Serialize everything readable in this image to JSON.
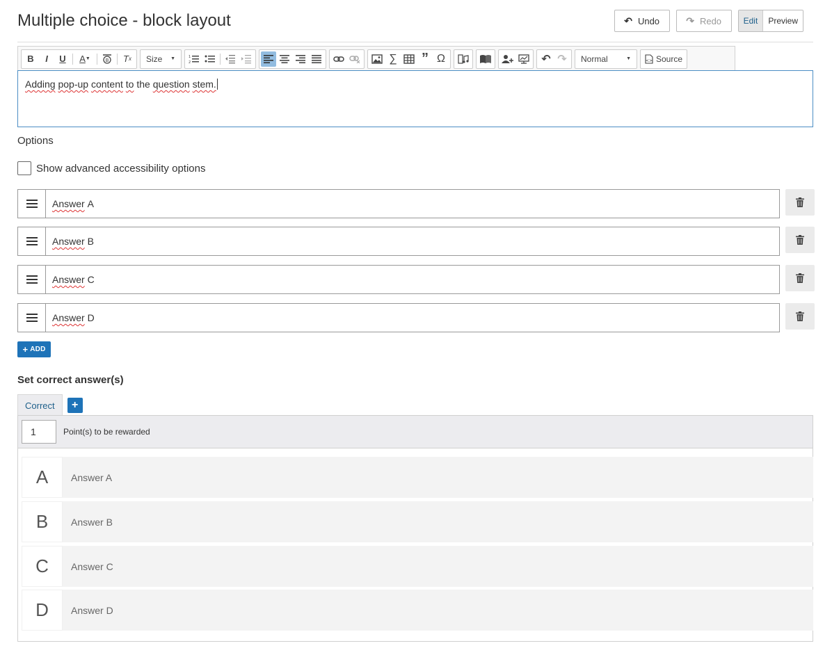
{
  "page": {
    "title": "Multiple choice - block layout"
  },
  "actions": {
    "undo": "Undo",
    "redo": "Redo",
    "edit": "Edit",
    "preview": "Preview"
  },
  "toolbar": {
    "size_label": "Size",
    "format_label": "Normal",
    "source_label": "Source",
    "icons": [
      "bold-icon",
      "italic-icon",
      "underline-icon",
      "text-color-icon",
      "bg-color-icon",
      "clear-format-icon",
      "ordered-list-icon",
      "bullet-list-icon",
      "outdent-icon",
      "indent-icon",
      "align-left-icon",
      "align-center-icon",
      "align-right-icon",
      "justify-icon",
      "link-icon",
      "unlink-icon",
      "image-icon",
      "math-icon",
      "table-icon",
      "blockquote-icon",
      "special-char-icon",
      "audio-icon",
      "book-icon",
      "user-add-icon",
      "presentation-icon",
      "undo-icon",
      "redo-icon",
      "source-icon"
    ]
  },
  "editor": {
    "words": [
      "Adding",
      "pop-up",
      "content",
      "to",
      "the",
      "question",
      "stem."
    ]
  },
  "options": {
    "label": "Options",
    "advanced_label": "Show advanced accessibility options",
    "items": [
      {
        "word": "Answer",
        "letter": "A"
      },
      {
        "word": "Answer",
        "letter": "B"
      },
      {
        "word": "Answer",
        "letter": "C"
      },
      {
        "word": "Answer",
        "letter": "D"
      }
    ],
    "add_label": "ADD"
  },
  "correct": {
    "heading": "Set correct answer(s)",
    "tab_label": "Correct",
    "points_value": "1",
    "points_label": "Point(s) to be rewarded",
    "answers": [
      {
        "letter": "A",
        "text": "Answer A"
      },
      {
        "letter": "B",
        "text": "Answer B"
      },
      {
        "letter": "C",
        "text": "Answer C"
      },
      {
        "letter": "D",
        "text": "Answer D"
      }
    ]
  },
  "colors": {
    "accent": "#1e73b8",
    "editor_border": "#4b8dc4",
    "active_tool": "#92bce0"
  }
}
